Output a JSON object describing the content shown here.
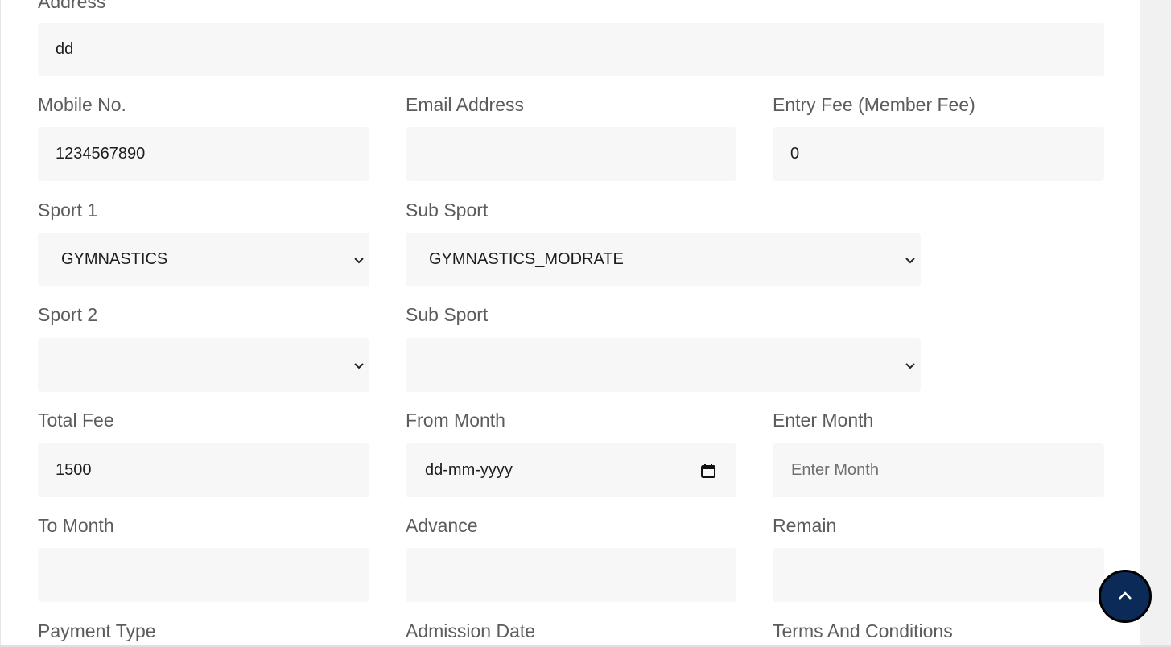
{
  "form": {
    "address": {
      "label": "Address",
      "value": "dd"
    },
    "mobile": {
      "label": "Mobile No.",
      "value": "1234567890"
    },
    "email": {
      "label": "Email Address",
      "value": ""
    },
    "entry_fee": {
      "label": "Entry Fee (Member Fee)",
      "value": "0"
    },
    "sport1": {
      "label": "Sport 1",
      "selected": "GYMNASTICS"
    },
    "sub_sport1": {
      "label": "Sub Sport",
      "selected": "GYMNASTICS_MODRATE"
    },
    "sport2": {
      "label": "Sport 2",
      "selected": ""
    },
    "sub_sport2": {
      "label": "Sub Sport",
      "selected": ""
    },
    "total_fee": {
      "label": "Total Fee",
      "value": "1500"
    },
    "from_month": {
      "label": "From Month",
      "value": "dd-mm-yyyy"
    },
    "enter_month": {
      "label": "Enter Month",
      "placeholder": "Enter Month"
    },
    "to_month": {
      "label": "To Month",
      "value": ""
    },
    "advance": {
      "label": "Advance",
      "value": ""
    },
    "remain": {
      "label": "Remain",
      "value": ""
    },
    "payment_type": {
      "label": "Payment Type"
    },
    "admission_date": {
      "label": "Admission Date"
    },
    "terms": {
      "label": "Terms And Conditions"
    }
  },
  "icons": {
    "chevron": "chevron-down-icon",
    "calendar": "calendar-icon",
    "scroll_top": "chevron-up-icon"
  },
  "colors": {
    "field_bg": "#f7f7f7",
    "label": "#5c5c5c",
    "scroll_button": "#0b2a57"
  }
}
